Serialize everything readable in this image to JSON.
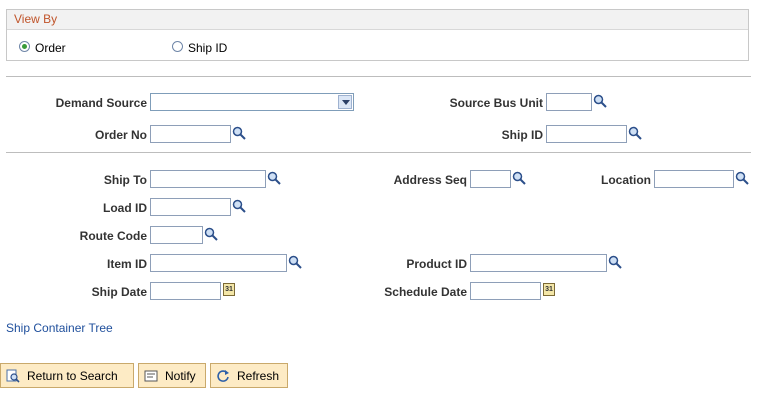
{
  "view_by": {
    "title": "View By",
    "options": [
      {
        "label": "Order",
        "selected": true
      },
      {
        "label": "Ship ID",
        "selected": false
      }
    ]
  },
  "criteria": {
    "demand_source": {
      "label": "Demand Source",
      "value": ""
    },
    "source_bus_unit": {
      "label": "Source Bus Unit",
      "value": ""
    },
    "order_no": {
      "label": "Order No",
      "value": ""
    },
    "ship_id": {
      "label": "Ship ID",
      "value": ""
    }
  },
  "filters": {
    "ship_to": {
      "label": "Ship To",
      "value": ""
    },
    "address_seq": {
      "label": "Address Seq",
      "value": ""
    },
    "location": {
      "label": "Location",
      "value": ""
    },
    "load_id": {
      "label": "Load ID",
      "value": ""
    },
    "route_code": {
      "label": "Route Code",
      "value": ""
    },
    "item_id": {
      "label": "Item ID",
      "value": ""
    },
    "product_id": {
      "label": "Product ID",
      "value": ""
    },
    "ship_date": {
      "label": "Ship Date",
      "value": ""
    },
    "schedule_date": {
      "label": "Schedule Date",
      "value": ""
    }
  },
  "links": {
    "ship_container_tree": "Ship Container Tree"
  },
  "buttons": {
    "return_to_search": "Return to Search",
    "notify": "Notify",
    "refresh": "Refresh"
  },
  "calendar_icon_text": "31",
  "colors": {
    "section_title": "#c0542a",
    "link": "#1f4f9c",
    "button_bg": "#fdebc5",
    "radio_selected": "#3a9b3a"
  }
}
